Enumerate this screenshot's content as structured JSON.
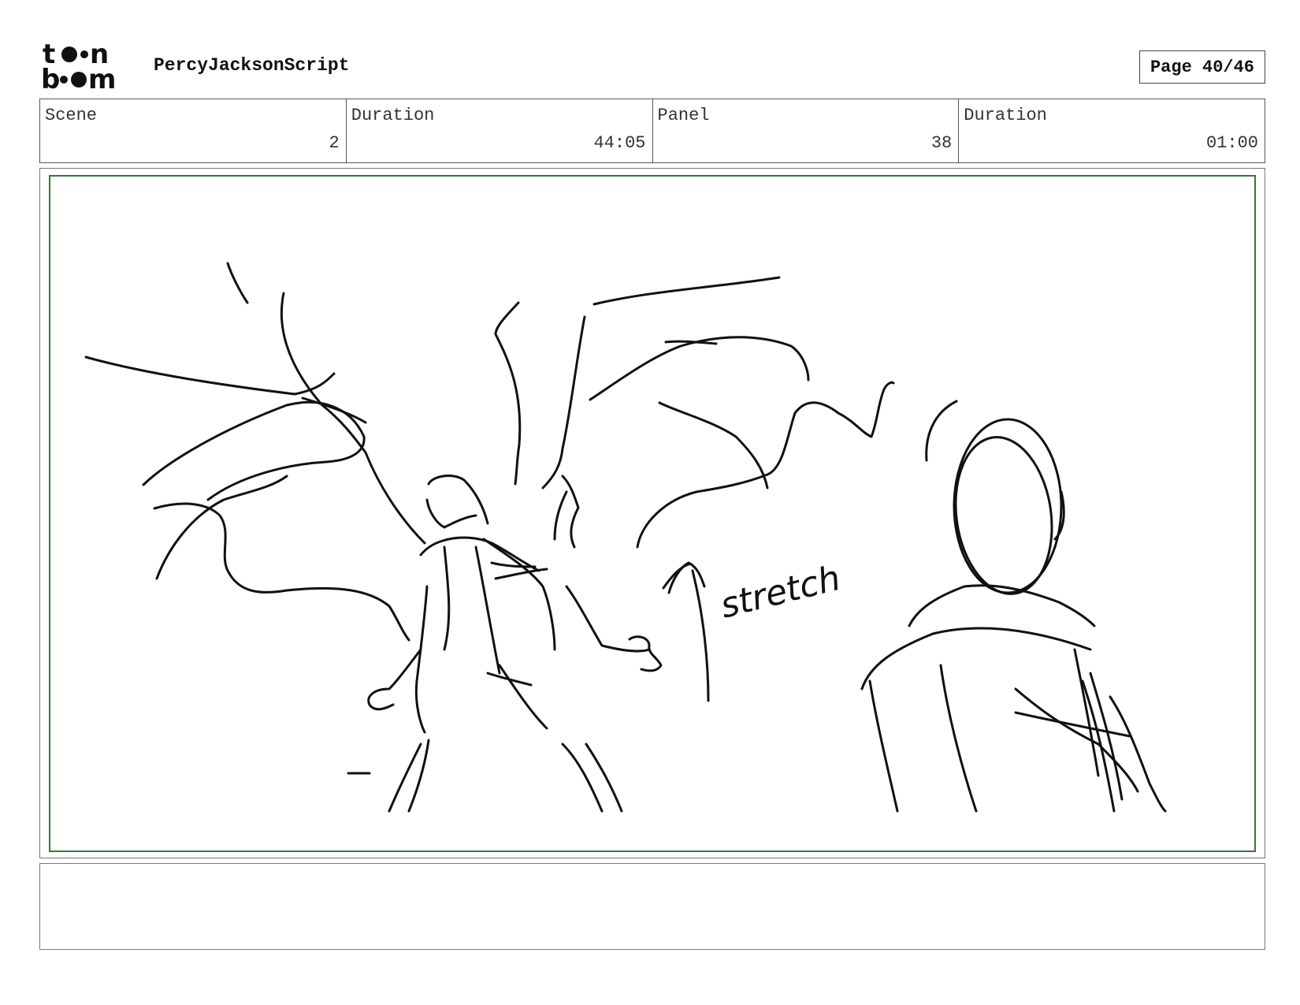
{
  "header": {
    "logo_text": "toonboom",
    "project_title": "PercyJacksonScript",
    "page_label": "Page 40/46"
  },
  "info": {
    "scene_label": "Scene",
    "scene_value": "2",
    "scene_duration_label": "Duration",
    "scene_duration_value": "44:05",
    "panel_label": "Panel",
    "panel_value": "38",
    "panel_duration_label": "Duration",
    "panel_duration_value": "01:00"
  },
  "panel": {
    "annotation_text": "stretch",
    "safe_area_color": "#2e7d32"
  },
  "notes": {
    "text": ""
  }
}
